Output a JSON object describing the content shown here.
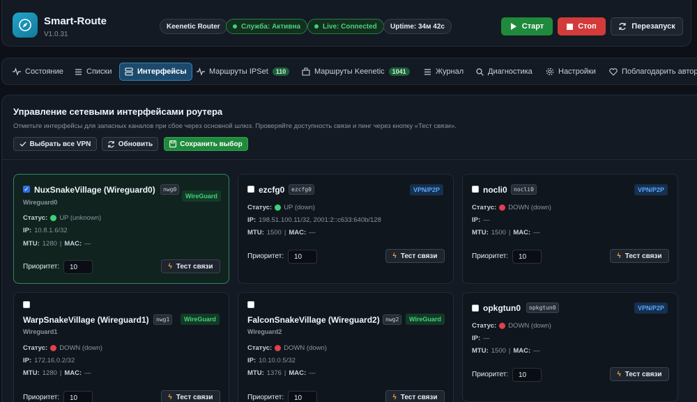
{
  "app": {
    "title": "Smart-Route",
    "version": "V1.0.31"
  },
  "status": {
    "router": "Keenetic Router",
    "service": "Служба: Активна",
    "live": "Live: Connected",
    "uptime": "Uptime: 34м 42с"
  },
  "actions": {
    "start": "Старт",
    "stop": "Стоп",
    "restart": "Перезапуск"
  },
  "tabs": [
    {
      "label": "Состояние",
      "icon": "activity-icon"
    },
    {
      "label": "Списки",
      "icon": "list-icon"
    },
    {
      "label": "Интерфейсы",
      "icon": "server-icon",
      "active": true
    },
    {
      "label": "Маршруты IPSet",
      "icon": "activity-icon",
      "badge": "110"
    },
    {
      "label": "Маршруты Keenetic",
      "icon": "package-icon",
      "badge": "1041"
    },
    {
      "label": "Журнал",
      "icon": "list-icon"
    },
    {
      "label": "Диагностика",
      "icon": "search-icon"
    },
    {
      "label": "Настройки",
      "icon": "gear-icon"
    },
    {
      "label": "Поблагодарить автор",
      "icon": "heart-icon"
    }
  ],
  "section": {
    "title": "Управление сетевыми интерфейсами роутера",
    "subtitle": "Отметьте интерфейсы для запасных каналов при сбое через основной шлюз. Проверяйте доступность связи и пинг через кнопку «Тест связи».",
    "select_all": "Выбрать все VPN",
    "refresh": "Обновить",
    "save": "Сохранить выбор"
  },
  "labels": {
    "status": "Статус:",
    "ip": "IP:",
    "mtu": "MTU:",
    "mac": "MAC:",
    "priority": "Приоритет:",
    "test": "Тест связи"
  },
  "interfaces": [
    {
      "name": "NuxSnakeVillage (Wireguard0)",
      "code": "nwg0",
      "type": "WireGuard",
      "subtitle": "Wireguard0",
      "status": "UP (unknown)",
      "ip": "10.8.1.6/32",
      "mtu": "1280",
      "mac": "—",
      "priority": "10",
      "checked": true
    },
    {
      "name": "ezcfg0",
      "code": "ezcfg0",
      "type": "VPN/P2P",
      "subtitle": "",
      "status": "UP (down)",
      "ip": "198.51.100.11/32, 2001:2::c633:640b/128",
      "mtu": "1500",
      "mac": "—",
      "priority": "10",
      "checked": false
    },
    {
      "name": "nocli0",
      "code": "nocli0",
      "type": "VPN/P2P",
      "subtitle": "",
      "status": "DOWN (down)",
      "ip": "—",
      "mtu": "1500",
      "mac": "—",
      "priority": "10",
      "checked": false
    },
    {
      "name": "WarpSnakeVillage (Wireguard1)",
      "code": "nwg1",
      "type": "WireGuard",
      "subtitle": "Wireguard1",
      "status": "DOWN (down)",
      "ip": "172.16.0.2/32",
      "mtu": "1280",
      "mac": "—",
      "priority": "10",
      "checked": false
    },
    {
      "name": "FalconSnakeVillage (Wireguard2)",
      "code": "nwg2",
      "type": "WireGuard",
      "subtitle": "Wireguard2",
      "status": "DOWN (down)",
      "ip": "10.10.0.5/32",
      "mtu": "1376",
      "mac": "—",
      "priority": "10",
      "checked": false
    },
    {
      "name": "opkgtun0",
      "code": "opkgtun0",
      "type": "VPN/P2P",
      "subtitle": "",
      "status": "DOWN (down)",
      "ip": "—",
      "mtu": "1500",
      "mac": "—",
      "priority": "10",
      "checked": false
    }
  ]
}
